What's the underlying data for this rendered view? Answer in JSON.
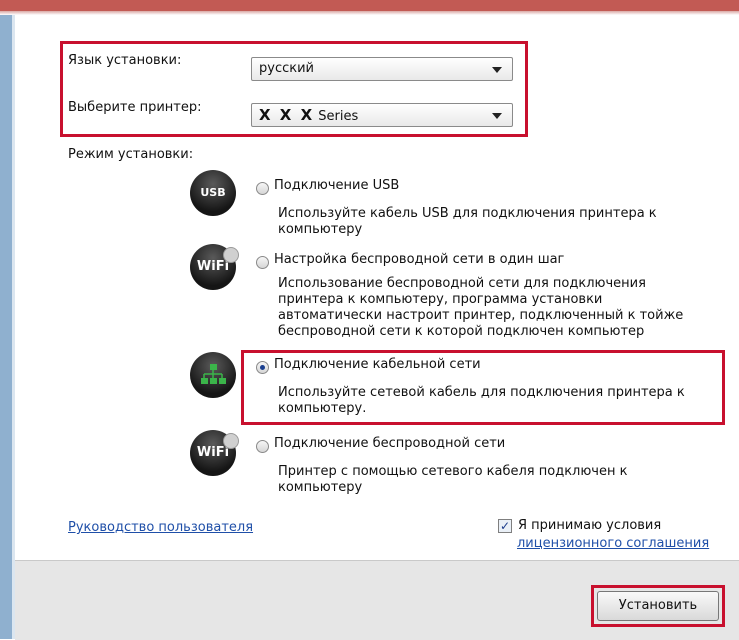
{
  "install_language": {
    "label": "Язык установки:",
    "value": "русский"
  },
  "printer": {
    "label": "Выберите принтер:",
    "value_main": "X X X",
    "value_suffix": "Series"
  },
  "mode_label": "Режим установки:",
  "options": [
    {
      "icon": "usb-icon",
      "icon_text": "USB",
      "title": "Подключение USB",
      "desc_lines": [
        "Используйте кабель USB для подключения принтера к",
        "компьютеру"
      ],
      "selected": false
    },
    {
      "icon": "wifi-icon",
      "icon_text": "WiFi",
      "title": "Настройка беспроводной сети в один шаг",
      "desc_lines": [
        "Использование беспроводной сети для подключения",
        "принтера к компьютеру, программа установки",
        "автоматически настроит принтер, подключенный к тойже",
        "беспроводной сети к которой подключен компьютер"
      ],
      "selected": false
    },
    {
      "icon": "network-icon",
      "icon_text": "",
      "title": "Подключение кабельной сети",
      "desc_lines": [
        "Используйте сетевой кабель для подключения принтера к",
        "компьютеру."
      ],
      "selected": true
    },
    {
      "icon": "wifi-icon",
      "icon_text": "WiFi",
      "title": "Подключение беспроводной сети",
      "desc_lines": [
        "Принтер с помощью сетевого кабеля подключен к",
        "компьютеру"
      ],
      "selected": false
    }
  ],
  "user_guide_link": "Руководство пользователя",
  "accept": {
    "checked": true,
    "text": "Я принимаю условия",
    "link": "лицензионного соглашения"
  },
  "install_button": "Установить"
}
